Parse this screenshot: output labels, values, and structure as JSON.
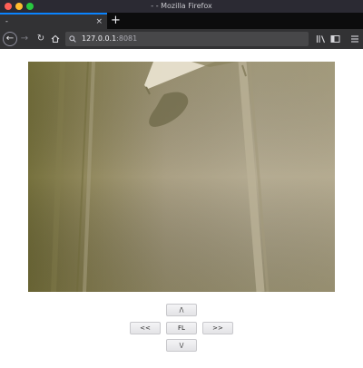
{
  "window": {
    "title": "- - Mozilla Firefox"
  },
  "tabs": [
    {
      "title": "-",
      "close_icon": "×"
    }
  ],
  "new_tab_icon": "+",
  "navbar": {
    "url_host": "127.0.0.1",
    "url_port": ":8081",
    "icons": {
      "back": "arrow-left-icon",
      "forward": "arrow-right-icon",
      "reload": "reload-icon",
      "home": "home-icon",
      "library": "library-icon",
      "sidebar": "sidebar-icon",
      "menu": "hamburger-menu-icon"
    }
  },
  "controls": {
    "up": "/\\",
    "left": "<<",
    "fl": "FL",
    "right": ">>",
    "down": "\\/"
  }
}
